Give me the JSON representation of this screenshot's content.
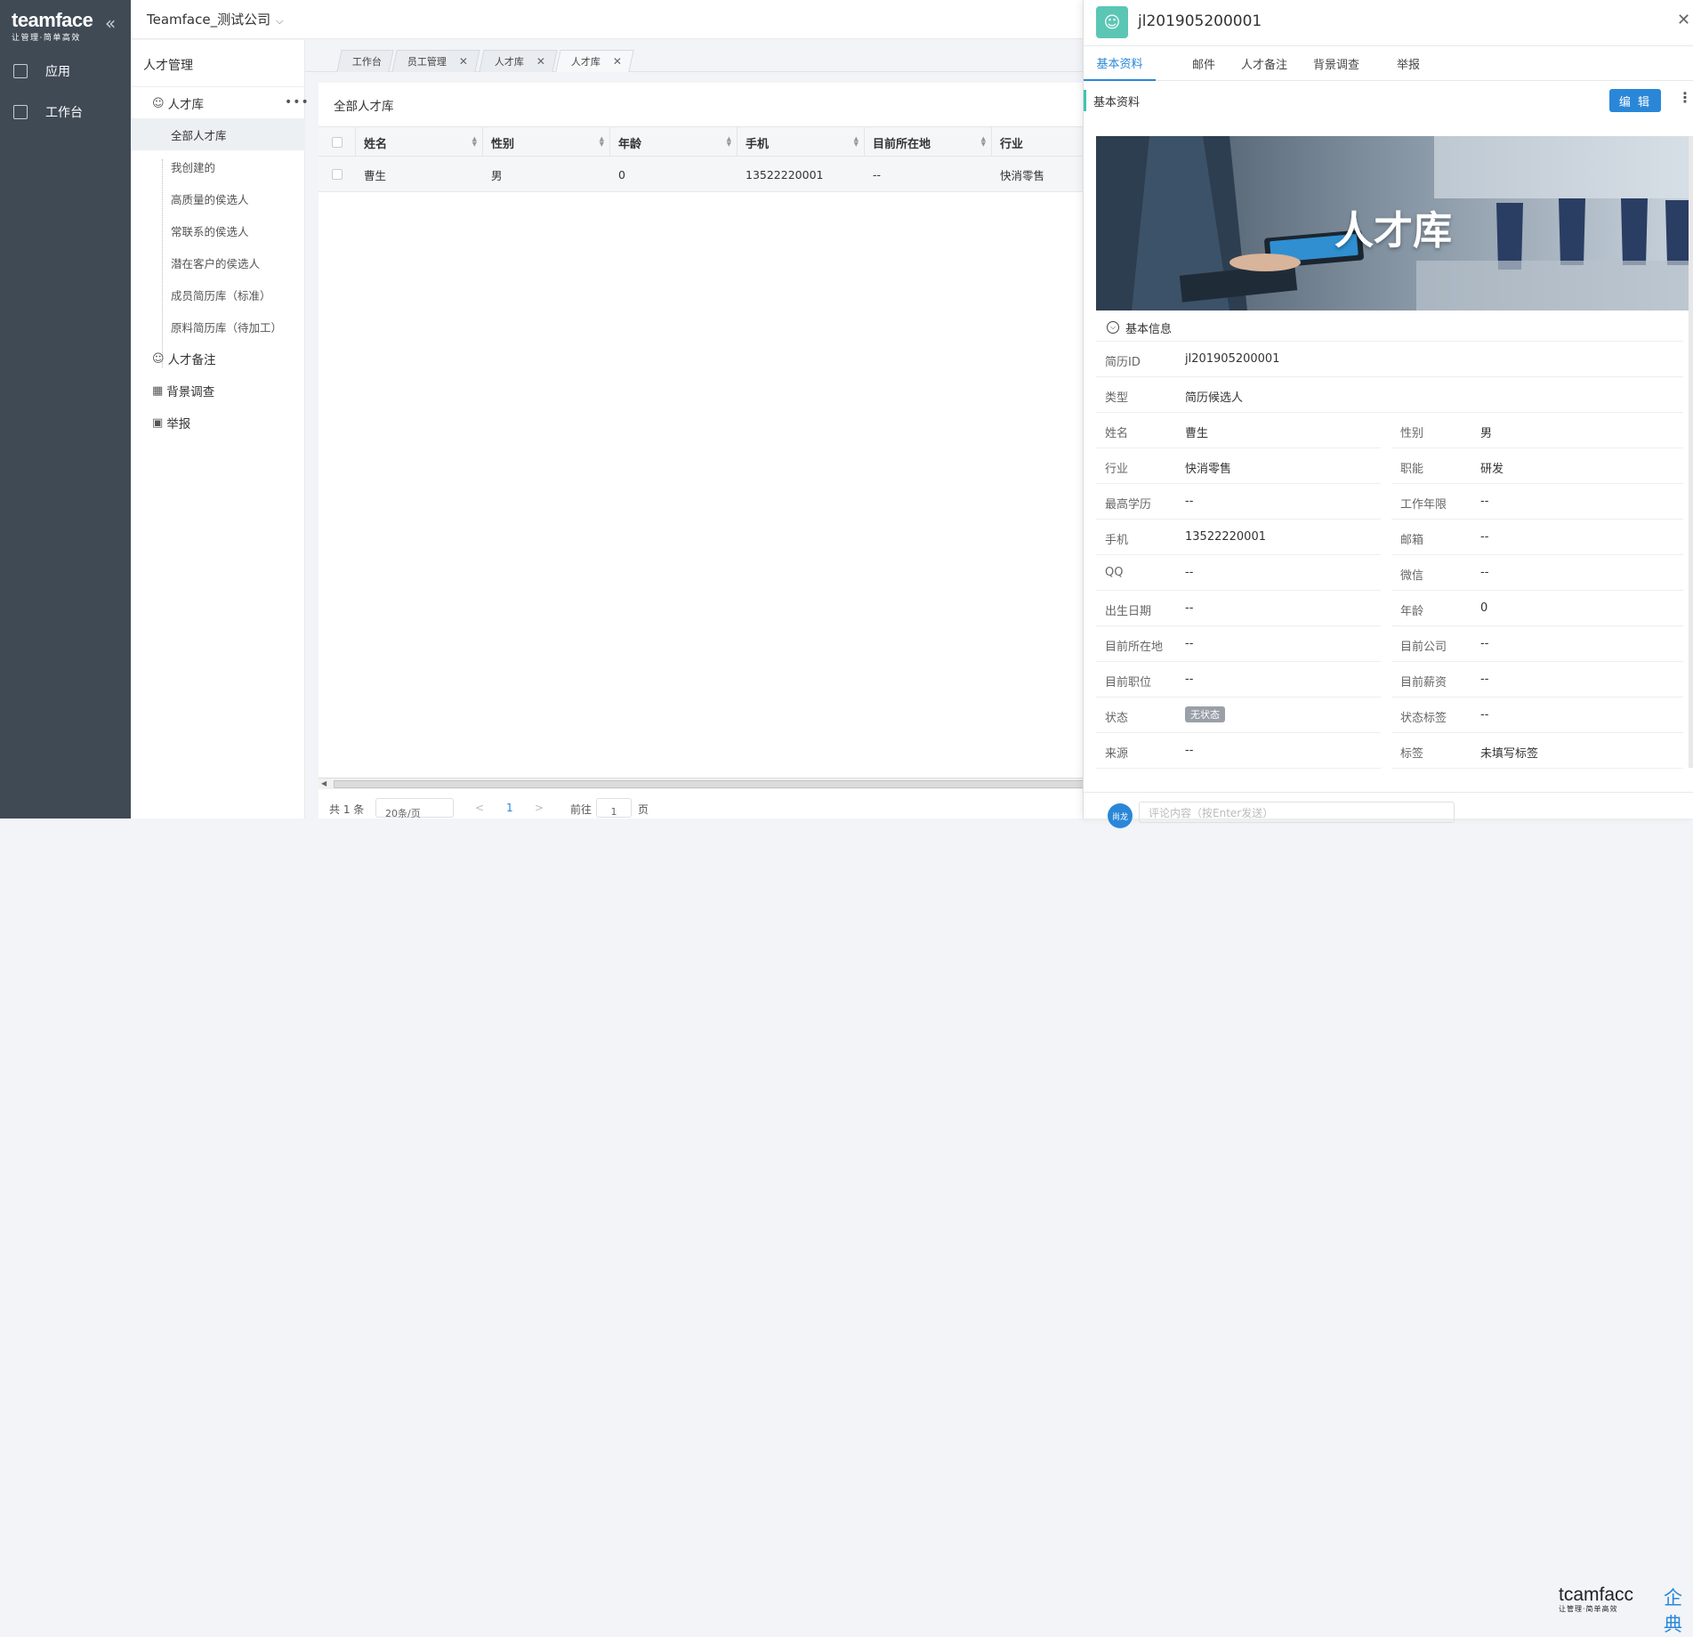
{
  "nav": {
    "logo_main": "teamface",
    "logo_sub": "让管理·简单高效",
    "items": [
      {
        "label": "应用",
        "icon": "apps-icon"
      },
      {
        "label": "工作台",
        "icon": "workbench-icon"
      }
    ]
  },
  "topbar": {
    "company": "Teamface_测试公司"
  },
  "sidebar": {
    "title": "人才管理",
    "root": "人才库",
    "children": [
      "全部人才库",
      "我创建的",
      "高质量的侯选人",
      "常联系的侯选人",
      "潜在客户的侯选人",
      "成员简历库（标准）",
      "原料简历库（待加工）"
    ],
    "others": [
      {
        "label": "人才备注",
        "icon": "people-icon"
      },
      {
        "label": "背景调查",
        "icon": "book-icon"
      },
      {
        "label": "举报",
        "icon": "box-icon"
      }
    ]
  },
  "tabs": [
    {
      "label": "工作台",
      "closable": false
    },
    {
      "label": "员工管理",
      "closable": true
    },
    {
      "label": "人才库",
      "closable": true
    },
    {
      "label": "人才库",
      "closable": true,
      "active": true
    }
  ],
  "list": {
    "title": "全部人才库",
    "columns": [
      "姓名",
      "性别",
      "年龄",
      "手机",
      "目前所在地",
      "行业"
    ],
    "rows": [
      [
        "曹生",
        "男",
        "0",
        "13522220001",
        "--",
        "快消零售"
      ]
    ],
    "pager": {
      "total": "共 1 条",
      "page_size": "20条/页",
      "page": "1",
      "goto": "前往",
      "goto_value": "1",
      "unit": "页"
    }
  },
  "detail": {
    "title": "jl201905200001",
    "tabs": [
      "基本资料",
      "邮件",
      "人才备注",
      "背景调查",
      "举报"
    ],
    "section_label": "基本资料",
    "edit_label": "编 辑",
    "banner_text": "人才库",
    "group_label": "基本信息",
    "fields_full": [
      {
        "label": "简历ID",
        "value": "jl201905200001"
      },
      {
        "label": "类型",
        "value": "简历候选人"
      }
    ],
    "fields_pairs": [
      [
        {
          "label": "姓名",
          "value": "曹生"
        },
        {
          "label": "性别",
          "value": "男"
        }
      ],
      [
        {
          "label": "行业",
          "value": "快消零售"
        },
        {
          "label": "职能",
          "value": "研发"
        }
      ],
      [
        {
          "label": "最高学历",
          "value": "--"
        },
        {
          "label": "工作年限",
          "value": "--"
        }
      ],
      [
        {
          "label": "手机",
          "value": "13522220001"
        },
        {
          "label": "邮箱",
          "value": "--"
        }
      ],
      [
        {
          "label": "QQ",
          "value": "--"
        },
        {
          "label": "微信",
          "value": "--"
        }
      ],
      [
        {
          "label": "出生日期",
          "value": "--"
        },
        {
          "label": "年龄",
          "value": "0"
        }
      ],
      [
        {
          "label": "目前所在地",
          "value": "--"
        },
        {
          "label": "目前公司",
          "value": "--"
        }
      ],
      [
        {
          "label": "目前职位",
          "value": "--"
        },
        {
          "label": "目前薪资",
          "value": "--"
        }
      ],
      [
        {
          "label": "状态",
          "value": "无状态"
        },
        {
          "label": "状态标签",
          "value": "--"
        }
      ],
      [
        {
          "label": "来源",
          "value": "--"
        },
        {
          "label": "标签",
          "value": "未填写标签"
        }
      ]
    ],
    "comment_avatar": "尚龙",
    "comment_placeholder": "评论内容（按Enter发送）"
  },
  "brand": {
    "main": "tcamfacc",
    "sub": "让管理·简单高效",
    "cn": "企典"
  }
}
